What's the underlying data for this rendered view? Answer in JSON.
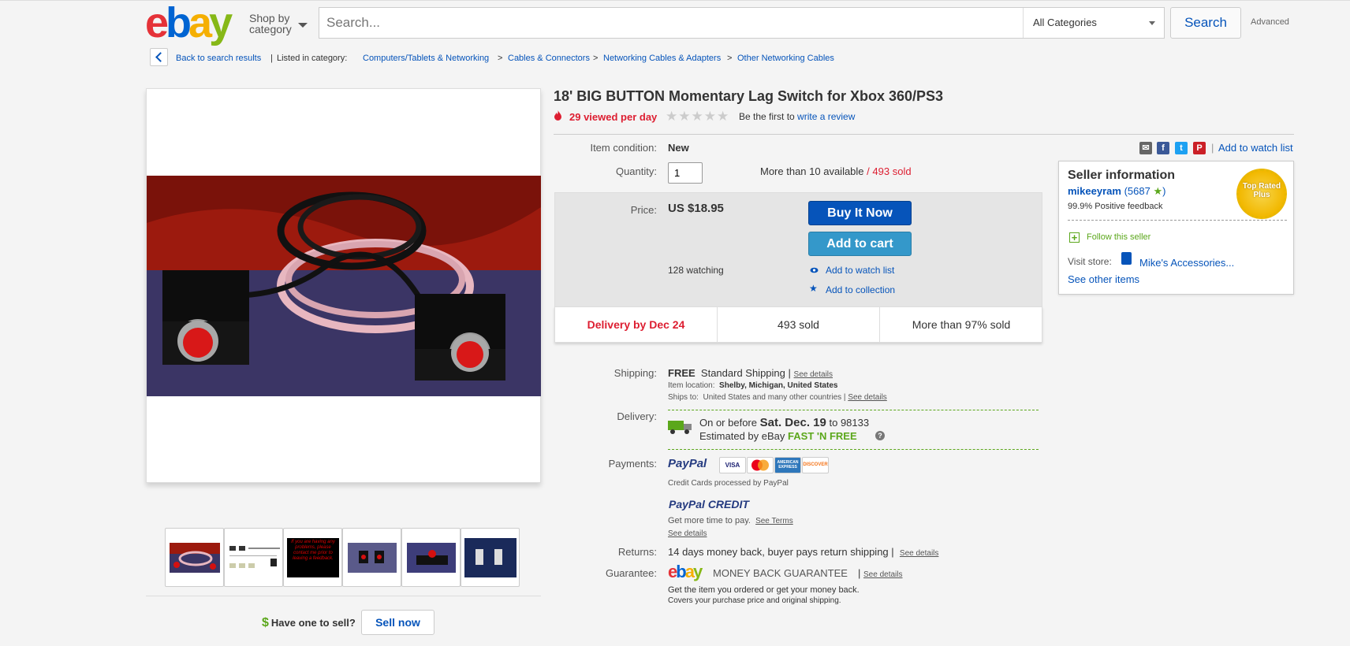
{
  "header": {
    "logo_letters": [
      "e",
      "b",
      "a",
      "y"
    ],
    "shop_by_line1": "Shop by",
    "shop_by_line2": "category",
    "search_placeholder": "Search...",
    "category_select": "All Categories",
    "search_button": "Search",
    "advanced_link": "Advanced"
  },
  "breadcrumb": {
    "back": "Back to search results",
    "separator": "|",
    "listed_in": "Listed in category:",
    "items": [
      "Computers/Tablets & Networking",
      "Cables & Connectors",
      "Networking Cables & Adapters",
      "Other Networking Cables"
    ],
    "arrow": ">"
  },
  "gallery": {
    "thumb3_text": "If you are having any problems, please contact me prior to leaving a feedback.",
    "sell_question": "Have one to sell?",
    "sell_dollar": "$",
    "sell_button": "Sell now"
  },
  "listing": {
    "title": "18' BIG BUTTON Momentary Lag Switch for Xbox 360/PS3",
    "viewed": "29 viewed per day",
    "stars": "★★★★★",
    "review_prefix": "Be the first to",
    "review_link": "write a review"
  },
  "details": {
    "condition_label": "Item condition:",
    "condition_value": "New",
    "quantity_label": "Quantity:",
    "quantity_value": "1",
    "available": "More than 10 available",
    "slash": "/",
    "sold_count": "493 sold",
    "price_label": "Price:",
    "price": "US $18.95",
    "buy_now": "Buy It Now",
    "add_cart": "Add to cart",
    "watching": "128 watching",
    "watch_link": "Add to watch list",
    "collection_link": "Add to collection",
    "stats": [
      "Delivery by Dec 24",
      "493 sold",
      "More than 97% sold"
    ]
  },
  "share": {
    "watch_link": "Add to watch list",
    "separator": "|",
    "icons": [
      "email-icon",
      "facebook-icon",
      "twitter-icon",
      "pinterest-icon"
    ]
  },
  "seller": {
    "heading": "Seller information",
    "name": "mikeeyram",
    "score_open": "(5687",
    "score_close": ")",
    "feedback": "99.9% Positive feedback",
    "badge_text": "Top Rated Plus",
    "follow": "Follow this seller",
    "visit_label": "Visit store:",
    "store_name": "Mike's Accessories...",
    "other_items": "See other items"
  },
  "shipping": {
    "label": "Shipping:",
    "free": "FREE",
    "method": "Standard Shipping",
    "sep": "|",
    "see_details": "See details",
    "location_label": "Item location:",
    "location": "Shelby, Michigan, United States",
    "ships_label": "Ships to:",
    "ships_to": "United States and many other countries",
    "ships_sep": "|",
    "ships_details": "See details"
  },
  "delivery": {
    "label": "Delivery:",
    "prefix": "On or before",
    "date": "Sat. Dec. 19",
    "to": "to",
    "zip": "98133",
    "estimated": "Estimated by",
    "ebay": "eBay",
    "fast": "FAST 'N FREE",
    "help": "?"
  },
  "payments": {
    "label": "Payments:",
    "paypal": "PayPal",
    "cards": [
      "VISA",
      "MasterCard",
      "AMERICAN EXPRESS",
      "DISCOVER"
    ],
    "processed": "Credit Cards processed by PayPal",
    "credit_logo": "PayPal CREDIT",
    "credit_text": "Get more time to pay.",
    "see_terms": "See Terms",
    "see_details": "See details"
  },
  "returns": {
    "label": "Returns:",
    "text": "14 days money back, buyer pays return shipping",
    "sep": "|",
    "see_details": "See details"
  },
  "guarantee": {
    "label": "Guarantee:",
    "logo_text": "MONEY BACK GUARANTEE",
    "sep": "|",
    "see_details": "See details",
    "line1": "Get the item you ordered or get your money back.",
    "line2": "Covers your purchase price and original shipping."
  },
  "colors": {
    "ebay_red": "#e53238",
    "ebay_blue": "#0064d2",
    "ebay_yellow": "#f5af02",
    "ebay_green": "#86b817",
    "link": "#0654ba",
    "alert_red": "#dd1e31",
    "buy_button": "#0654ba",
    "cart_button": "#3498ca"
  }
}
